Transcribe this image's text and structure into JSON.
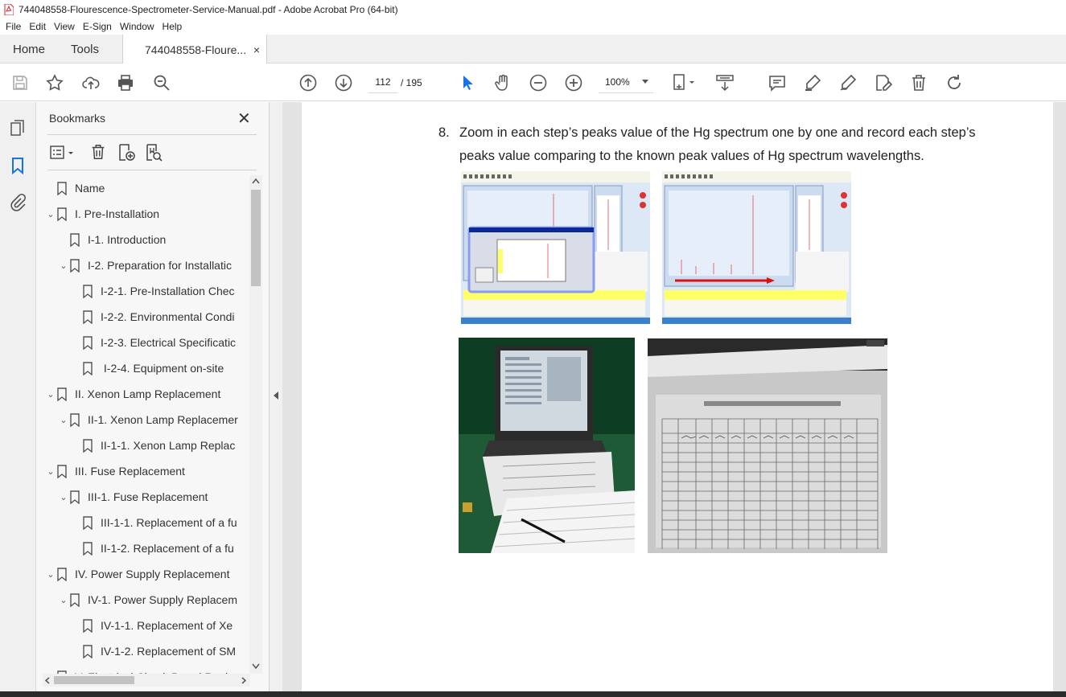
{
  "window": {
    "title": "744048558-Flourescence-Spectrometer-Service-Manual.pdf - Adobe Acrobat Pro (64-bit)"
  },
  "menu": [
    "File",
    "Edit",
    "View",
    "E-Sign",
    "Window",
    "Help"
  ],
  "tabs": {
    "home": "Home",
    "tools": "Tools",
    "doc": "744048558-Floure...",
    "close": "×"
  },
  "toolbar": {
    "page_current": "112",
    "page_total": "/  195",
    "zoom": "100%"
  },
  "bookmarks": {
    "title": "Bookmarks",
    "close": "✕",
    "items": [
      {
        "label": "Name",
        "level": 0,
        "chevron": ""
      },
      {
        "label": "I. Pre-Installation",
        "level": 0,
        "chevron": "⌄"
      },
      {
        "label": "I-1. Introduction",
        "level": 1,
        "chevron": ""
      },
      {
        "label": "I-2. Preparation for Installatic",
        "level": 1,
        "chevron": "⌄"
      },
      {
        "label": "I-2-1. Pre-Installation Chec",
        "level": 2,
        "chevron": ""
      },
      {
        "label": "I-2-2. Environmental Condi",
        "level": 2,
        "chevron": ""
      },
      {
        "label": "I-2-3. Electrical Specificatic",
        "level": 2,
        "chevron": ""
      },
      {
        "label": " I-2-4. Equipment on-site",
        "level": 2,
        "chevron": ""
      },
      {
        "label": "II. Xenon Lamp Replacement",
        "level": 0,
        "chevron": "⌄"
      },
      {
        "label": "II-1. Xenon Lamp Replacemer",
        "level": 1,
        "chevron": "⌄"
      },
      {
        "label": "II-1-1. Xenon Lamp Replac",
        "level": 2,
        "chevron": ""
      },
      {
        "label": "III. Fuse Replacement",
        "level": 0,
        "chevron": "⌄"
      },
      {
        "label": "III-1. Fuse Replacement",
        "level": 1,
        "chevron": "⌄"
      },
      {
        "label": "III-1-1. Replacement of a fu",
        "level": 2,
        "chevron": ""
      },
      {
        "label": "II-1-2. Replacement of a fu",
        "level": 2,
        "chevron": ""
      },
      {
        "label": "IV. Power Supply Replacement",
        "level": 0,
        "chevron": "⌄"
      },
      {
        "label": "IV-1. Power Supply Replacem",
        "level": 1,
        "chevron": "⌄"
      },
      {
        "label": "IV-1-1. Replacement of Xe",
        "level": 2,
        "chevron": ""
      },
      {
        "label": "IV-1-2. Replacement of SM",
        "level": 2,
        "chevron": ""
      },
      {
        "label": "V. Electrical Circuit Board Repl",
        "level": 0,
        "chevron": "⌄"
      }
    ]
  },
  "document": {
    "step_number": "8.",
    "step_text": "Zoom in each step’s peaks value of the Hg spectrum one by one and record each step’s peaks value comparing to the known peak values of Hg spectrum wavelengths."
  },
  "colors": {
    "accent": "#1473e6",
    "pdf_red": "#e02020",
    "tab_bg": "#f0f0f0"
  }
}
